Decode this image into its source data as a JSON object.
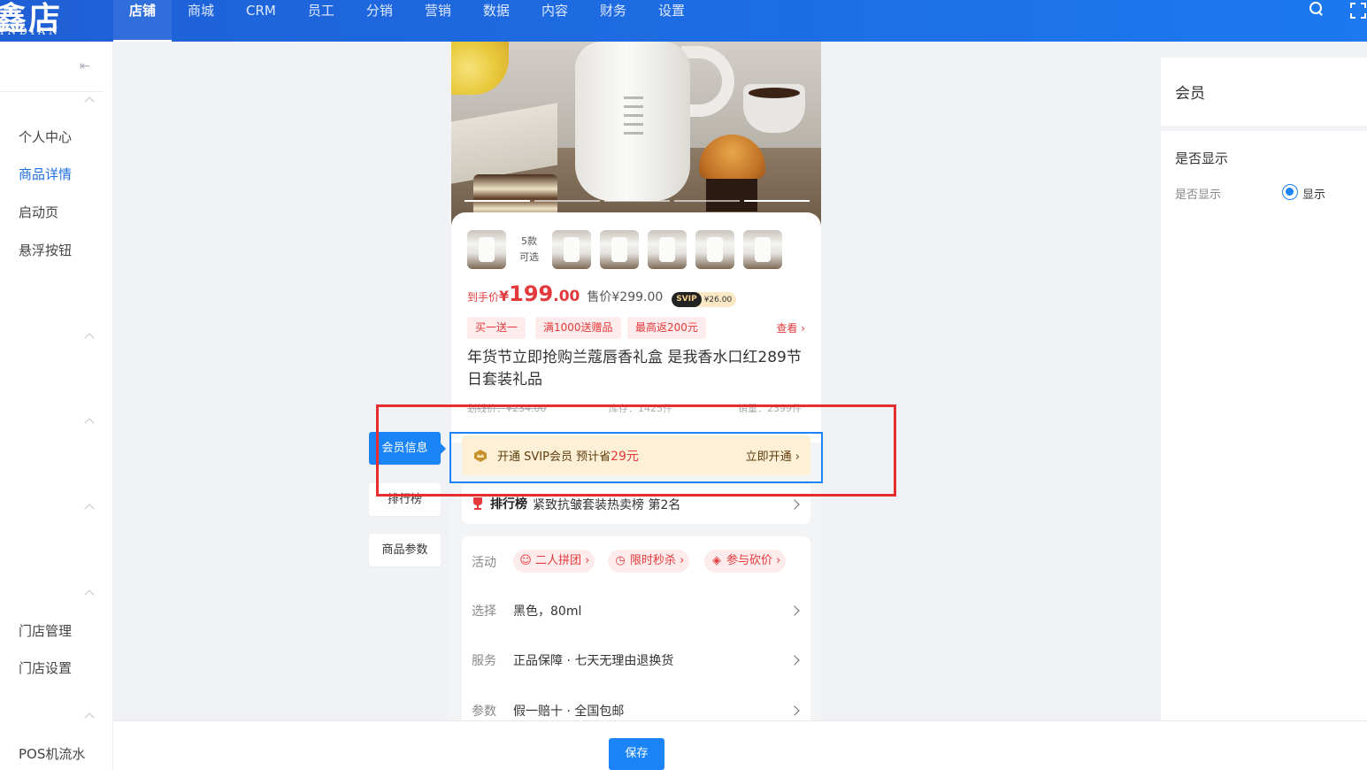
{
  "brand": {
    "logo_main": "鑫店",
    "logo_sub": "INDIAN"
  },
  "nav": {
    "items": [
      {
        "label": "店铺"
      },
      {
        "label": "商城"
      },
      {
        "label": "CRM"
      },
      {
        "label": "员工"
      },
      {
        "label": "分销"
      },
      {
        "label": "营销"
      },
      {
        "label": "数据"
      },
      {
        "label": "内容"
      },
      {
        "label": "财务"
      },
      {
        "label": "设置"
      }
    ],
    "active_index": 0
  },
  "sidebar": {
    "items": [
      {
        "label": "个人中心"
      },
      {
        "label": "商品详情"
      },
      {
        "label": "启动页"
      },
      {
        "label": "悬浮按钮"
      },
      {
        "label": "门店管理"
      },
      {
        "label": "门店设置"
      },
      {
        "label": "POS机流水"
      }
    ],
    "active_label": "商品详情"
  },
  "product": {
    "sku_count_line1": "5款",
    "sku_count_line2": "可选",
    "price_label": "到手价",
    "price_yen": "¥",
    "price_int": "199",
    "price_dec": ".00",
    "sale_price": "售价¥299.00",
    "svip_tag": "SVIP",
    "svip_price": "¥26.00",
    "promos": [
      "买一送一",
      "满1000送赠品",
      "最高返200元"
    ],
    "promo_more": "查看",
    "title": "年货节立即抢购兰蔻唇香礼盒 是我香水口红289节日套装礼品",
    "list_price": "划线价：¥234.00",
    "stock": "库存：1425件",
    "sales": "销量：2399件"
  },
  "vip": {
    "text_prefix": "开通 SVIP会员 预计省",
    "save_amount": "29元",
    "open_label": "立即开通"
  },
  "rank": {
    "brand": "排行榜",
    "text": "紧致抗皱套装热卖榜 第2名"
  },
  "params": {
    "activity_label": "活动",
    "activities": [
      "二人拼团",
      "限时秒杀",
      "参与砍价"
    ],
    "select_label": "选择",
    "select_value": "黑色，80ml",
    "service_label": "服务",
    "service_value": "正品保障 · 七天无理由退换货",
    "param_label": "参数",
    "param_value": "假一赔十 · 全国包邮"
  },
  "side_tabs": [
    {
      "label": "会员信息"
    },
    {
      "label": "排行榜"
    },
    {
      "label": "商品参数"
    }
  ],
  "right_panel": {
    "title": "会员",
    "section": "是否显示",
    "field_label": "是否显示",
    "radio_label": "显示",
    "radio_checked": true
  },
  "footer": {
    "save_label": "保存"
  },
  "colors": {
    "primary": "#1b85f7",
    "nav_bg": "#1c79f0",
    "price_red": "#e4393c",
    "highlight_box": "#e62e2e"
  }
}
